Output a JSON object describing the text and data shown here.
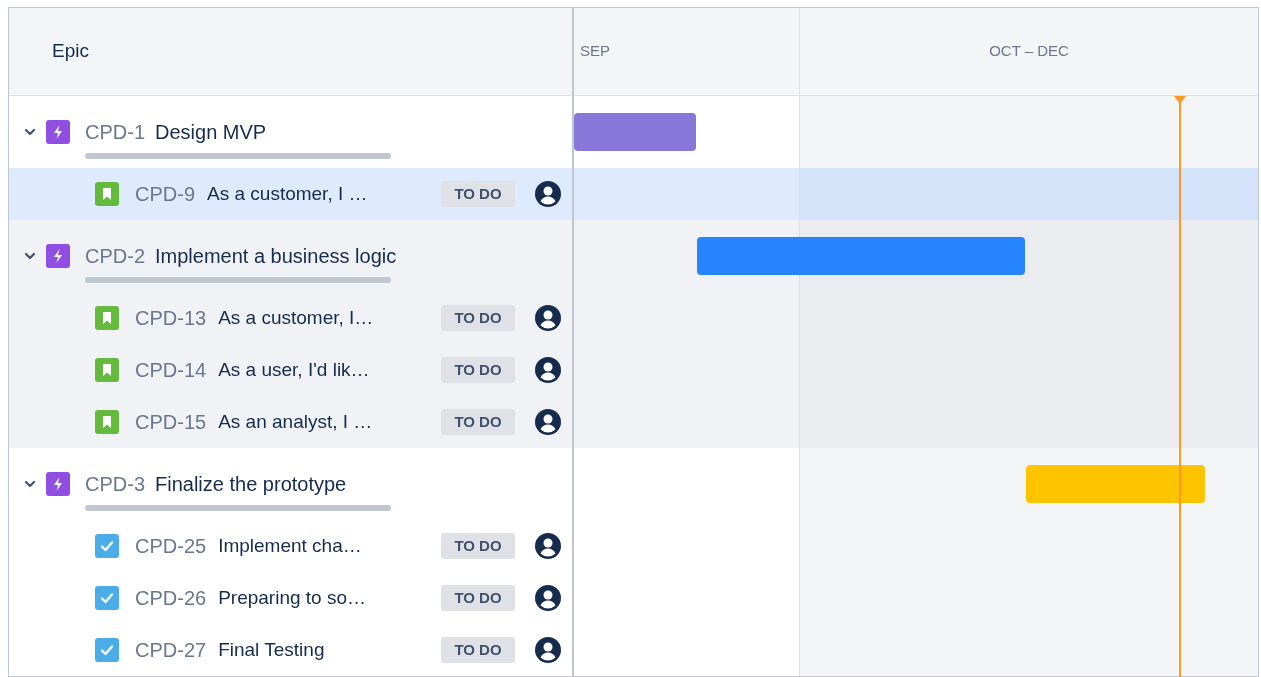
{
  "header": {
    "epic_column": "Epic",
    "periods": [
      "SEP",
      "OCT – DEC"
    ]
  },
  "epics": [
    {
      "key": "CPD-1",
      "summary": "Design MVP",
      "expanded": true,
      "hovered": false,
      "color": "#8777d9",
      "children": [
        {
          "kind": "story",
          "key": "CPD-9",
          "summary": "As a customer, I …",
          "status": "TO DO",
          "selected": true
        }
      ]
    },
    {
      "key": "CPD-2",
      "summary": "Implement a business logic",
      "expanded": true,
      "hovered": true,
      "color": "#2684ff",
      "children": [
        {
          "kind": "story",
          "key": "CPD-13",
          "summary": "As a customer, I…",
          "status": "TO DO",
          "selected": false
        },
        {
          "kind": "story",
          "key": "CPD-14",
          "summary": "As a user, I'd lik…",
          "status": "TO DO",
          "selected": false
        },
        {
          "kind": "story",
          "key": "CPD-15",
          "summary": "As an analyst, I …",
          "status": "TO DO",
          "selected": false
        }
      ]
    },
    {
      "key": "CPD-3",
      "summary": "Finalize the prototype",
      "expanded": true,
      "hovered": false,
      "color": "#ffc400",
      "children": [
        {
          "kind": "task",
          "key": "CPD-25",
          "summary": "Implement cha…",
          "status": "TO DO",
          "selected": false
        },
        {
          "kind": "task",
          "key": "CPD-26",
          "summary": "Preparing to so…",
          "status": "TO DO",
          "selected": false
        },
        {
          "kind": "task",
          "key": "CPD-27",
          "summary": "Final Testing",
          "status": "TO DO",
          "selected": false
        }
      ]
    }
  ]
}
